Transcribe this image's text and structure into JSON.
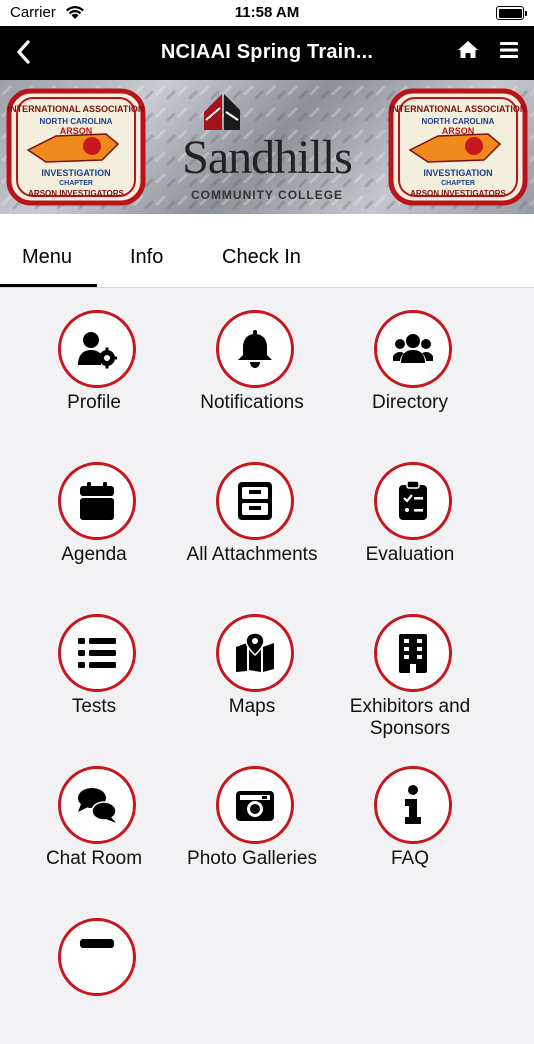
{
  "status_bar": {
    "carrier": "Carrier",
    "time": "11:58 AM"
  },
  "nav": {
    "title": "NCIAAI Spring Train...",
    "back_icon": "chevron-left-icon",
    "home_icon": "home-icon",
    "menu_icon": "hamburger-menu-icon"
  },
  "banner": {
    "badge_left": {
      "top_text": "INTERNATIONAL ASSOCIATION",
      "state_text": "NORTH CAROLINA",
      "arson_text": "ARSON",
      "investigation_text": "INVESTIGATION",
      "chapter_text": "CHAPTER",
      "bottom_text": "ARSON INVESTIGATORS"
    },
    "badge_right": {
      "top_text": "INTERNATIONAL ASSOCIATION",
      "state_text": "NORTH CAROLINA",
      "arson_text": "ARSON",
      "investigation_text": "INVESTIGATION",
      "chapter_text": "CHAPTER",
      "bottom_text": "ARSON INVESTIGATORS"
    },
    "college_name": "Sandhills",
    "college_sub": "COMMUNITY COLLEGE"
  },
  "tabs": [
    {
      "label": "Menu",
      "active": true
    },
    {
      "label": "Info",
      "active": false
    },
    {
      "label": "Check In",
      "active": false
    }
  ],
  "accent_color": "#c8161d",
  "menu_items": [
    {
      "label": "Profile",
      "icon": "user-cog-icon"
    },
    {
      "label": "Notifications",
      "icon": "bell-icon"
    },
    {
      "label": "Directory",
      "icon": "users-icon"
    },
    {
      "label": "Agenda",
      "icon": "calendar-icon"
    },
    {
      "label": "All Attachments",
      "icon": "file-cabinet-icon"
    },
    {
      "label": "Evaluation",
      "icon": "clipboard-check-icon"
    },
    {
      "label": "Tests",
      "icon": "list-icon"
    },
    {
      "label": "Maps",
      "icon": "map-icon"
    },
    {
      "label": "Exhibitors and Sponsors",
      "icon": "building-icon"
    },
    {
      "label": "Chat Room",
      "icon": "chat-bubbles-icon"
    },
    {
      "label": "Photo Galleries",
      "icon": "camera-icon"
    },
    {
      "label": "FAQ",
      "icon": "info-icon"
    },
    {
      "label": "",
      "icon": "more-icon"
    }
  ]
}
